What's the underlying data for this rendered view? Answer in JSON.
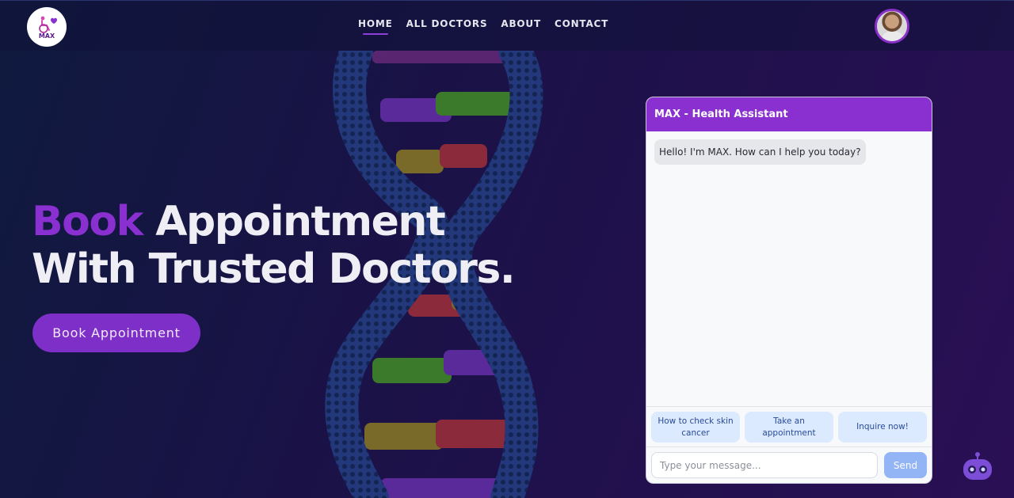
{
  "brand": {
    "logo_text": "MAX"
  },
  "nav": {
    "links": [
      {
        "label": "HOME",
        "active": true
      },
      {
        "label": "ALL DOCTORS",
        "active": false
      },
      {
        "label": "ABOUT",
        "active": false
      },
      {
        "label": "CONTACT",
        "active": false
      }
    ]
  },
  "hero": {
    "title_accent": "Book",
    "title_rest": " Appointment",
    "title_line2": "With Trusted Doctors.",
    "cta_label": "Book Appointment"
  },
  "chat": {
    "header": "MAX - Health Assistant",
    "messages": [
      {
        "from": "bot",
        "text": "Hello! I'm MAX. How can I help you today?"
      }
    ],
    "quick_replies": [
      "How to check skin cancer",
      "Take an appointment",
      "Inquire now!"
    ],
    "input_placeholder": "Type your message...",
    "send_label": "Send"
  },
  "colors": {
    "accent": "#8a2fd0",
    "quick_reply_bg": "#dbeafe",
    "send_bg": "#93b4f5"
  },
  "icons": {
    "logo": "wheelchair-heart-icon",
    "avatar": "user-avatar",
    "chatbot": "robot-icon"
  }
}
